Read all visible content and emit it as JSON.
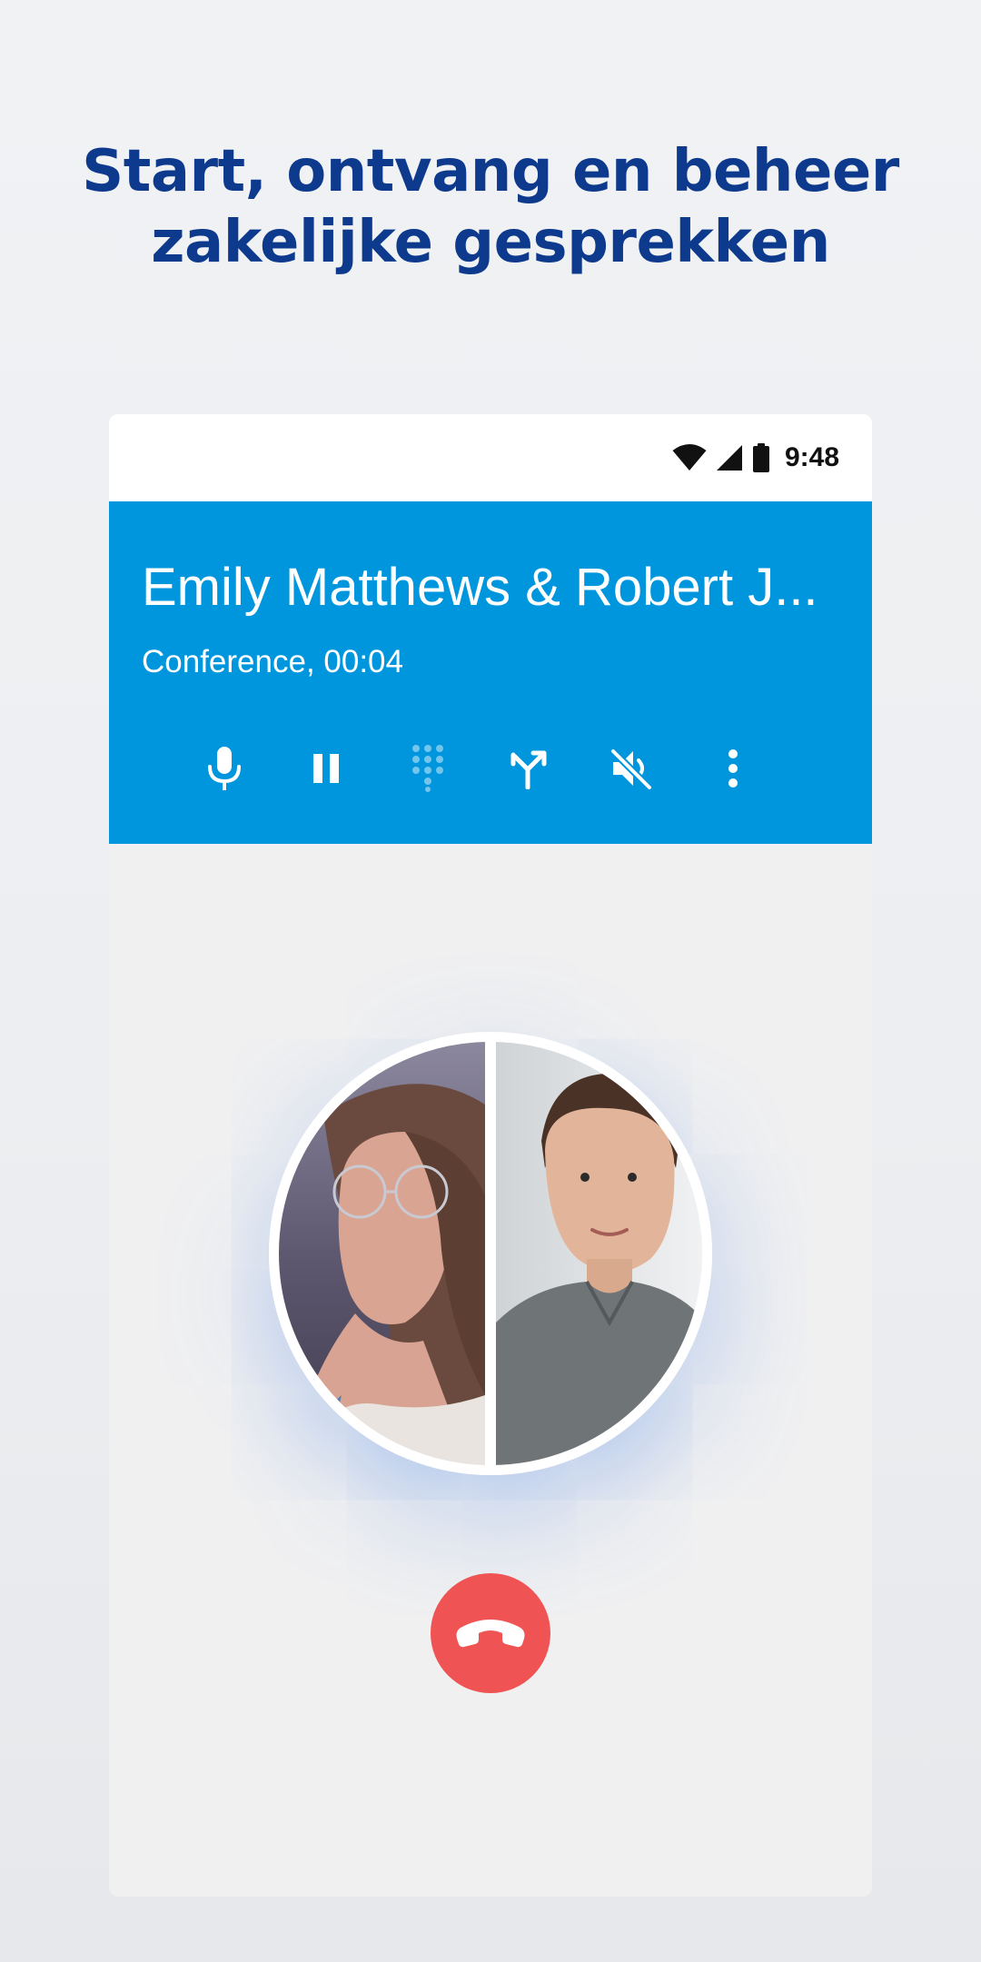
{
  "headline": {
    "line1": "Start, ontvang en beheer",
    "line2": "zakelijke gesprekken"
  },
  "status_bar": {
    "time": "9:48",
    "icons": [
      "wifi-icon",
      "signal-icon",
      "battery-icon"
    ]
  },
  "call": {
    "title": "Emily Matthews & Robert J...",
    "subtitle": "Conference, 00:04",
    "controls": [
      {
        "name": "microphone-icon",
        "enabled": true
      },
      {
        "name": "pause-icon",
        "enabled": true
      },
      {
        "name": "dialpad-icon",
        "enabled": false
      },
      {
        "name": "merge-call-icon",
        "enabled": true
      },
      {
        "name": "speaker-muted-icon",
        "enabled": true
      },
      {
        "name": "more-vertical-icon",
        "enabled": true
      }
    ],
    "participants_avatar": "conference-participants-avatar",
    "end_call_icon": "phone-hangup-icon"
  },
  "colors": {
    "headline": "#0d3a8c",
    "call_header": "#0096dd",
    "end_call": "#ef5353",
    "screen_background": "#f0f0f1"
  }
}
